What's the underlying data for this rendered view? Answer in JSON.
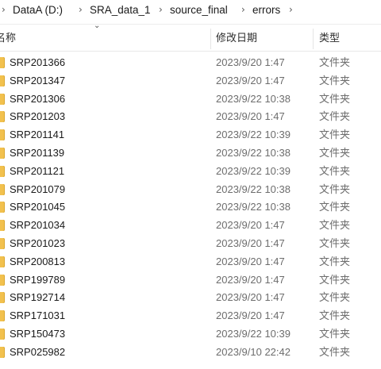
{
  "breadcrumb": {
    "items": [
      "DataA (D:)",
      "SRA_data_1",
      "source_final",
      "errors"
    ]
  },
  "columns": {
    "name": "名称",
    "date": "修改日期",
    "type": "类型"
  },
  "rows": [
    {
      "name": "SRP201366",
      "date": "2023/9/20 1:47",
      "type": "文件夹"
    },
    {
      "name": "SRP201347",
      "date": "2023/9/20 1:47",
      "type": "文件夹"
    },
    {
      "name": "SRP201306",
      "date": "2023/9/22 10:38",
      "type": "文件夹"
    },
    {
      "name": "SRP201203",
      "date": "2023/9/20 1:47",
      "type": "文件夹"
    },
    {
      "name": "SRP201141",
      "date": "2023/9/22 10:39",
      "type": "文件夹"
    },
    {
      "name": "SRP201139",
      "date": "2023/9/22 10:38",
      "type": "文件夹"
    },
    {
      "name": "SRP201121",
      "date": "2023/9/22 10:39",
      "type": "文件夹"
    },
    {
      "name": "SRP201079",
      "date": "2023/9/22 10:38",
      "type": "文件夹"
    },
    {
      "name": "SRP201045",
      "date": "2023/9/22 10:38",
      "type": "文件夹"
    },
    {
      "name": "SRP201034",
      "date": "2023/9/20 1:47",
      "type": "文件夹"
    },
    {
      "name": "SRP201023",
      "date": "2023/9/20 1:47",
      "type": "文件夹"
    },
    {
      "name": "SRP200813",
      "date": "2023/9/20 1:47",
      "type": "文件夹"
    },
    {
      "name": "SRP199789",
      "date": "2023/9/20 1:47",
      "type": "文件夹"
    },
    {
      "name": "SRP192714",
      "date": "2023/9/20 1:47",
      "type": "文件夹"
    },
    {
      "name": "SRP171031",
      "date": "2023/9/20 1:47",
      "type": "文件夹"
    },
    {
      "name": "SRP150473",
      "date": "2023/9/22 10:39",
      "type": "文件夹"
    },
    {
      "name": "SRP025982",
      "date": "2023/9/10 22:42",
      "type": "文件夹"
    }
  ],
  "icons": {
    "row_icon": "folder-icon",
    "separator": "chevron-right-icon",
    "sort": "chevron-down-icon"
  },
  "colors": {
    "folder": "#f2c14e",
    "secondary_text": "#6d6d6d"
  }
}
